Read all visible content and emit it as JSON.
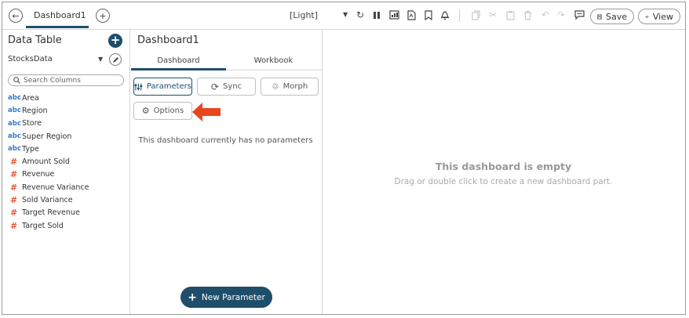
{
  "topbar": {
    "tab_label": "Dashboard1",
    "theme": "[Light]",
    "save_label": "Save",
    "view_label": "View"
  },
  "data_table": {
    "title": "Data Table",
    "datasource": "StocksData",
    "search_placeholder": "Search Columns",
    "columns": [
      {
        "type": "abc",
        "name": "Area"
      },
      {
        "type": "abc",
        "name": "Region"
      },
      {
        "type": "abc",
        "name": "Store"
      },
      {
        "type": "abc",
        "name": "Super Region"
      },
      {
        "type": "abc",
        "name": "Type"
      },
      {
        "type": "#",
        "name": "Amount Sold"
      },
      {
        "type": "#",
        "name": "Revenue"
      },
      {
        "type": "#",
        "name": "Revenue Variance"
      },
      {
        "type": "#",
        "name": "Sold Variance"
      },
      {
        "type": "#",
        "name": "Target Revenue"
      },
      {
        "type": "#",
        "name": "Target Sold"
      }
    ]
  },
  "dashboard_panel": {
    "title": "Dashboard1",
    "tabs": [
      "Dashboard",
      "Workbook"
    ],
    "buttons": {
      "parameters": "Parameters",
      "sync": "Sync",
      "morph": "Morph",
      "options": "Options"
    },
    "empty_message": "This dashboard currently has no parameters",
    "new_parameter": "New Parameter"
  },
  "canvas": {
    "empty_title": "This dashboard is empty",
    "empty_hint": "Drag or double click to create a new dashboard part."
  },
  "colors": {
    "accent": "#1f4e6b",
    "arrow": "#e8461e",
    "text_type": "#3a78c9",
    "numeric_type": "#e05a3a"
  }
}
